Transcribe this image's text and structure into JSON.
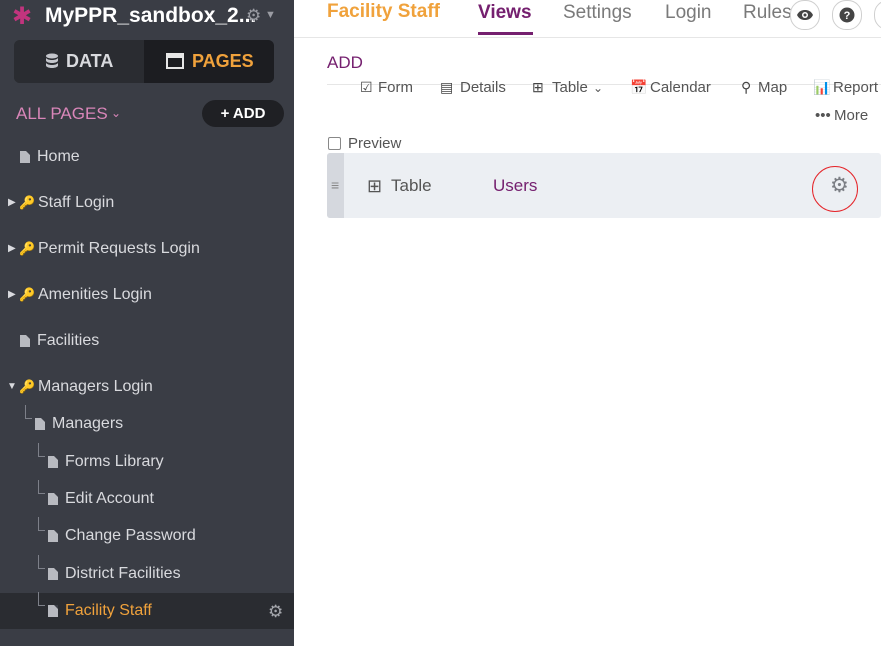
{
  "sidebar": {
    "app_name": "MyPPR_sandbox_2...",
    "segment": {
      "data_label": "DATA",
      "pages_label": "PAGES"
    },
    "all_pages_label": "ALL PAGES",
    "add_label": "+ ADD",
    "items": [
      {
        "label": "Home",
        "type": "page"
      },
      {
        "label": "Staff Login",
        "type": "login",
        "expanded": false
      },
      {
        "label": "Permit Requests Login",
        "type": "login",
        "expanded": false
      },
      {
        "label": "Amenities Login",
        "type": "login",
        "expanded": false
      },
      {
        "label": "Facilities",
        "type": "page"
      },
      {
        "label": "Managers Login",
        "type": "login",
        "expanded": true
      },
      {
        "label": "Managers",
        "type": "page",
        "depth": 1
      },
      {
        "label": "Forms Library",
        "type": "page",
        "depth": 2
      },
      {
        "label": "Edit Account",
        "type": "page",
        "depth": 2
      },
      {
        "label": "Change Password",
        "type": "page",
        "depth": 2
      },
      {
        "label": "District Facilities",
        "type": "page",
        "depth": 2
      },
      {
        "label": "Facility Staff",
        "type": "page",
        "depth": 2,
        "active": true
      }
    ]
  },
  "header": {
    "page_title": "Facility Staff",
    "tabs": [
      {
        "label": "Views",
        "active": true
      },
      {
        "label": "Settings"
      },
      {
        "label": "Login"
      },
      {
        "label": "Rules"
      }
    ],
    "icons": [
      "eye-icon",
      "help-icon"
    ]
  },
  "main": {
    "add_label": "ADD",
    "view_types": {
      "form": "Form",
      "details": "Details",
      "table": "Table",
      "calendar": "Calendar",
      "map": "Map",
      "report": "Report",
      "more": "More"
    },
    "preview_label": "Preview",
    "views": [
      {
        "type": "Table",
        "name": "Users"
      }
    ]
  },
  "colors": {
    "accent_orange": "#f0a23c",
    "accent_purple": "#75206f",
    "sidebar_bg": "#3a3d45",
    "highlight_red": "#e5252a"
  }
}
